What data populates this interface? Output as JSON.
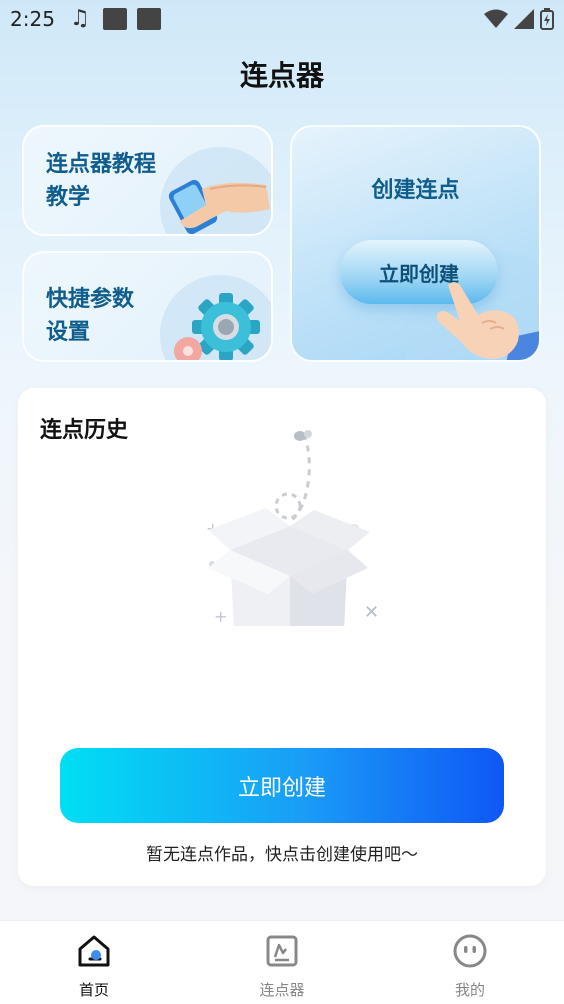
{
  "status_bar": {
    "time": "2:25",
    "note_glyph": "♫"
  },
  "page": {
    "title": "连点器"
  },
  "cards": {
    "tutorial": {
      "line1": "连点器教程",
      "line2": "教学"
    },
    "settings": {
      "line1": "快捷参数",
      "line2": "设置"
    },
    "create": {
      "title": "创建连点",
      "button_label": "立即创建"
    }
  },
  "history": {
    "title": "连点历史",
    "create_button": "立即创建",
    "empty_hint": "暂无连点作品，快点击创建使用吧～"
  },
  "bottom_nav": [
    {
      "label": "首页",
      "icon": "home-icon",
      "active": true
    },
    {
      "label": "连点器",
      "icon": "clicker-icon",
      "active": false
    },
    {
      "label": "我的",
      "icon": "profile-icon",
      "active": false
    }
  ],
  "colors": {
    "accent_blue": "#0f57f5",
    "accent_cyan": "#00dff3",
    "card_text": "#0f5d8c"
  }
}
